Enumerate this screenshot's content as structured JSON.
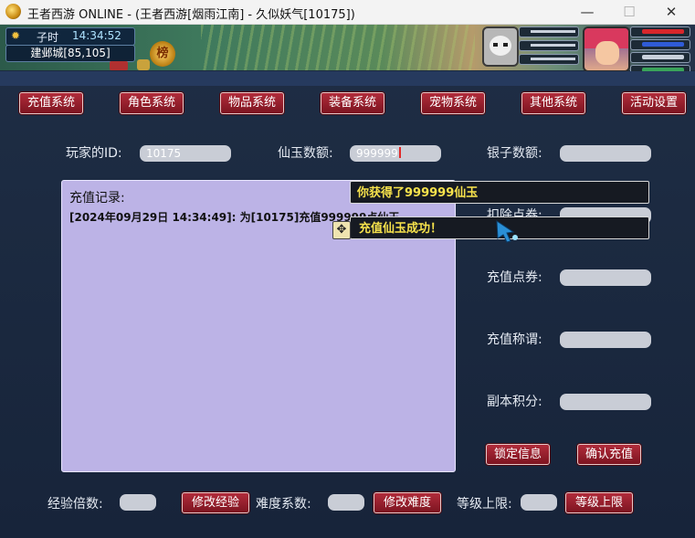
{
  "window": {
    "title": "王者西游 ONLINE -  (王者西游[烟雨江南] - 久似妖气[10175])",
    "min": "—",
    "max": "☐",
    "close": "✕"
  },
  "game_hud": {
    "shichen": "子时",
    "time": "14:34:52",
    "location": "建邺城[85,105]",
    "rank_badge": "榜"
  },
  "tabs": [
    "充值系统",
    "角色系统",
    "物品系统",
    "装备系统",
    "宠物系统",
    "其他系统",
    "活动设置"
  ],
  "form": {
    "player_id_label": "玩家的ID:",
    "player_id_value": "10175",
    "jade_label": "仙玉数额:",
    "jade_value": "999999",
    "silver_label": "银子数额:",
    "silver_value": "",
    "deduct_label": "扣除点券:",
    "recharge_points_label": "充值点券:",
    "recharge_title_label": "充值称谓:",
    "dungeon_points_label": "副本积分:"
  },
  "log": {
    "title": "充值记录:",
    "lines": [
      "[2024年09月29日 14:34:49]: 为[10175]充值999999点仙玉"
    ]
  },
  "buttons": {
    "lock_info": "锁定信息",
    "confirm_recharge": "确认充值",
    "modify_exp": "修改经验",
    "modify_difficulty": "修改难度",
    "level_cap": "等级上限"
  },
  "bottom": {
    "exp_multiplier_label": "经验倍数:",
    "difficulty_label": "难度系数:",
    "level_cap_label": "等级上限:"
  },
  "toasts": {
    "gain": "你获得了999999仙玉",
    "success": "充值仙玉成功！"
  },
  "colors": {
    "tab_red": "#9e1f2e",
    "panel_bg": "#1b2a3d",
    "log_bg": "#bcb3e6",
    "toast_text": "#f7e24c",
    "field_bg": "#c9cdd6"
  }
}
